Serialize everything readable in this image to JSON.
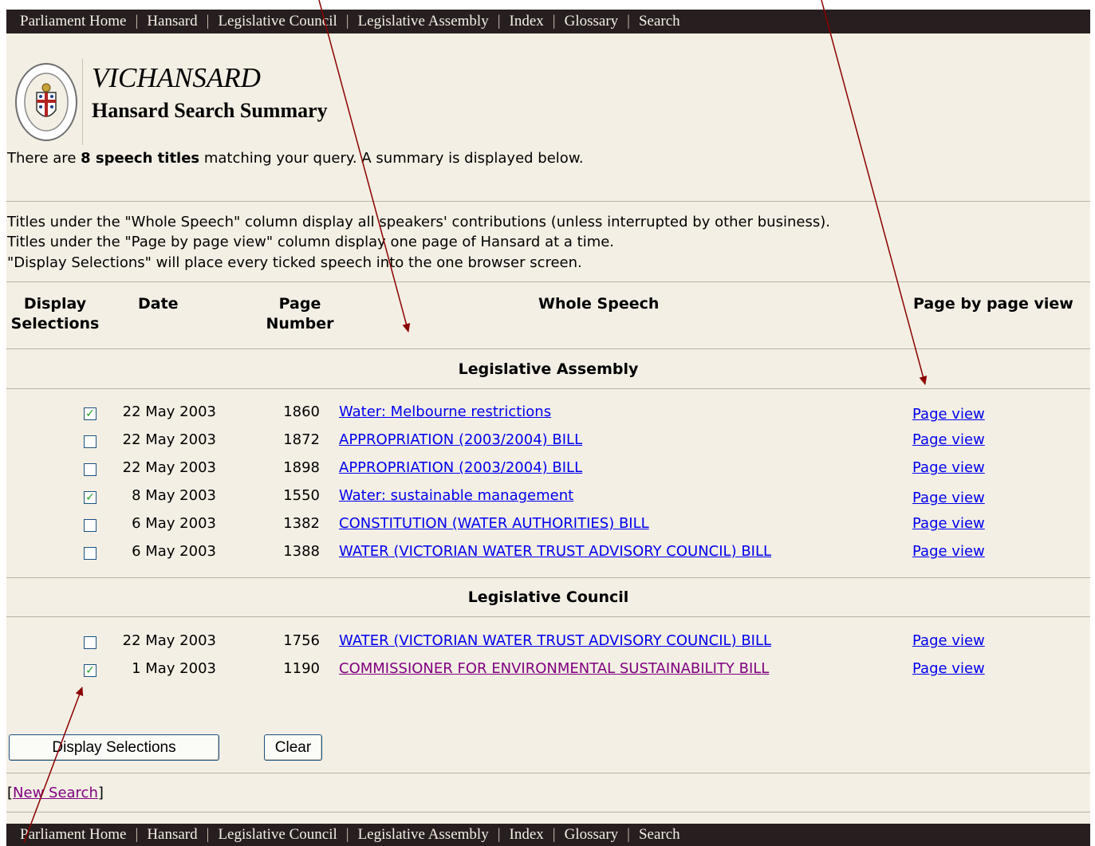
{
  "nav": {
    "items": [
      "Parliament Home",
      "Hansard",
      "Legislative Council",
      "Legislative Assembly",
      "Index",
      "Glossary",
      "Search"
    ],
    "separator": "|"
  },
  "header": {
    "title": "VICHANSARD",
    "subtitle": "Hansard Search Summary",
    "logo_text": "PARLIAMENT OF VICTORIA"
  },
  "summary": {
    "prefix": "There are ",
    "count_text": "8 speech titles",
    "suffix": " matching your query. A summary is displayed below."
  },
  "info": [
    "Titles under the \"Whole Speech\" column display all speakers' contributions (unless interrupted by other business).",
    "Titles under the \"Page by page view\" column display one page of Hansard at a time.",
    "\"Display Selections\" will place every ticked speech into the one browser screen."
  ],
  "table": {
    "headers": {
      "display_line1": "Display",
      "display_line2": "Selections",
      "date": "Date",
      "page_line1": "Page",
      "page_line2": "Number",
      "whole_speech": "Whole Speech",
      "page_by_page": "Page by page view"
    },
    "sections": [
      {
        "name": "Legislative Assembly",
        "rows": [
          {
            "checked": true,
            "date": "22 May 2003",
            "page": "1860",
            "title": "Water: Melbourne restrictions",
            "page_view": "Page view"
          },
          {
            "checked": false,
            "date": "22 May 2003",
            "page": "1872",
            "title": "APPROPRIATION (2003/2004) BILL",
            "page_view": "Page view"
          },
          {
            "checked": false,
            "date": "22 May 2003",
            "page": "1898",
            "title": "APPROPRIATION (2003/2004) BILL",
            "page_view": "Page view"
          },
          {
            "checked": true,
            "date": "8 May 2003",
            "page": "1550",
            "title": "Water: sustainable management",
            "page_view": "Page view"
          },
          {
            "checked": false,
            "date": "6 May 2003",
            "page": "1382",
            "title": "CONSTITUTION (WATER AUTHORITIES) BILL",
            "page_view": "Page view"
          },
          {
            "checked": false,
            "date": "6 May 2003",
            "page": "1388",
            "title": "WATER (VICTORIAN WATER TRUST ADVISORY COUNCIL) BILL",
            "page_view": "Page view"
          }
        ]
      },
      {
        "name": "Legislative Council",
        "rows": [
          {
            "checked": false,
            "date": "22 May 2003",
            "page": "1756",
            "title": "WATER (VICTORIAN WATER TRUST ADVISORY COUNCIL) BILL",
            "page_view": "Page view"
          },
          {
            "checked": true,
            "date": "1 May 2003",
            "page": "1190",
            "title": "COMMISSIONER FOR ENVIRONMENTAL SUSTAINABILITY BILL",
            "page_view": "Page view"
          }
        ]
      }
    ]
  },
  "buttons": {
    "display_selections": "Display Selections",
    "clear": "Clear"
  },
  "new_search": {
    "open": "[",
    "label": "New Search",
    "close": "]"
  },
  "colors": {
    "nav_bg": "#271e1f",
    "page_bg": "#f3efe4",
    "link": "#0000ee",
    "visited_link": "#800080",
    "annotation_arrow": "#8b0000",
    "checkmark": "#21a121"
  },
  "icons": {
    "logo": "parliament-crest-icon",
    "checkbox_checked": "checkmark-icon"
  }
}
